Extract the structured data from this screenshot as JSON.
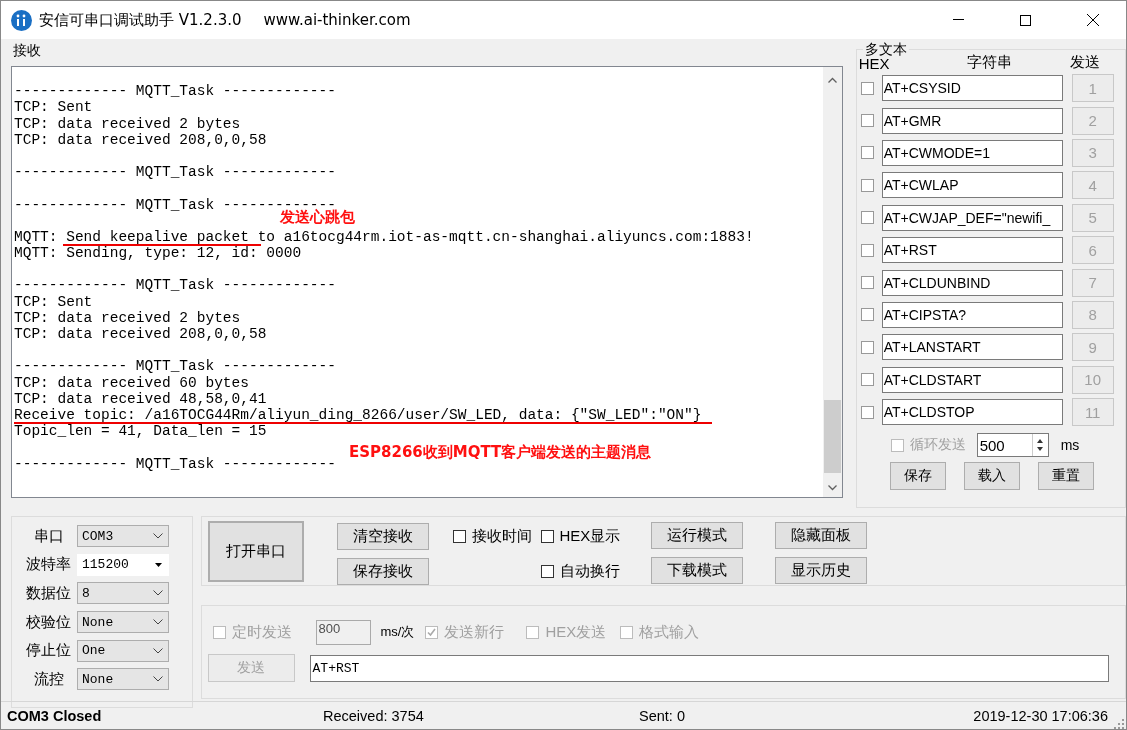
{
  "window": {
    "title": "安信可串口调试助手 V1.2.3.0",
    "url": "www.ai-thinker.com"
  },
  "receive": {
    "label": "接收",
    "blocks": [
      [
        "------------- MQTT_Task -------------",
        "TCP: Sent",
        "TCP: data received 2 bytes",
        "TCP: data received 208,0,0,58"
      ],
      [
        "------------- MQTT_Task -------------"
      ],
      [
        "------------- MQTT_Task -------------"
      ],
      [
        "MQTT: Send keepalive packet to a16tocg44rm.iot-as-mqtt.cn-shanghai.aliyuncs.com:1883!",
        "MQTT: Sending, type: 12, id: 0000"
      ],
      [
        "------------- MQTT_Task -------------",
        "TCP: Sent",
        "TCP: data received 2 bytes",
        "TCP: data received 208,0,0,58"
      ],
      [
        "------------- MQTT_Task -------------",
        "TCP: data received 60 bytes",
        "TCP: data received 48,58,0,41",
        "Receive topic: /a16TOCG44Rm/aliyun_ding_8266/user/SW_LED, data: {\"SW_LED\":\"ON\"}",
        "Topic_len = 41, Data_len = 15"
      ],
      [
        "------------- MQTT_Task -------------"
      ]
    ],
    "annotations": [
      {
        "text": "发送心跳包"
      },
      {
        "text": "ESP8266收到MQTT客户端发送的主题消息"
      }
    ]
  },
  "multi_text": {
    "title": "多文本",
    "headers": [
      "HEX",
      "字符串",
      "发送"
    ],
    "rows": [
      {
        "hex": false,
        "text": "AT+CSYSID",
        "button": "1",
        "disabled": true
      },
      {
        "hex": false,
        "text": "AT+GMR",
        "button": "2",
        "disabled": true
      },
      {
        "hex": false,
        "text": "AT+CWMODE=1",
        "button": "3",
        "disabled": true
      },
      {
        "hex": false,
        "text": "AT+CWLAP",
        "button": "4",
        "disabled": true
      },
      {
        "hex": false,
        "text": "AT+CWJAP_DEF=\"newifi_",
        "button": "5",
        "disabled": true
      },
      {
        "hex": false,
        "text": "AT+RST",
        "button": "6",
        "disabled": true
      },
      {
        "hex": false,
        "text": "AT+CLDUNBIND",
        "button": "7",
        "disabled": true
      },
      {
        "hex": false,
        "text": "AT+CIPSTA?",
        "button": "8",
        "disabled": true
      },
      {
        "hex": false,
        "text": "AT+LANSTART",
        "button": "9",
        "disabled": true
      },
      {
        "hex": false,
        "text": "AT+CLDSTART",
        "button": "10",
        "disabled": true
      },
      {
        "hex": false,
        "text": "AT+CLDSTOP",
        "button": "11",
        "disabled": true
      }
    ],
    "loop": {
      "label": "循环发送",
      "checked": false,
      "disabled": true,
      "interval": "500",
      "unit": "ms"
    },
    "buttons": [
      "保存",
      "载入",
      "重置"
    ]
  },
  "port_settings": [
    {
      "label": "串口",
      "value": "COM3",
      "kind": "dropdown"
    },
    {
      "label": "波特率",
      "value": "115200",
      "kind": "editable"
    },
    {
      "label": "数据位",
      "value": "8",
      "kind": "dropdown"
    },
    {
      "label": "校验位",
      "value": "None",
      "kind": "dropdown"
    },
    {
      "label": "停止位",
      "value": "One",
      "kind": "dropdown"
    },
    {
      "label": "流控",
      "value": "None",
      "kind": "dropdown"
    }
  ],
  "controls": {
    "open_button": "打开串口",
    "receive_buttons": [
      "清空接收",
      "保存接收"
    ],
    "checkboxes": [
      {
        "label": "接收时间",
        "checked": false
      },
      {
        "label": "HEX显示",
        "checked": false
      },
      {
        "label": "自动换行",
        "checked": false
      }
    ],
    "mode_buttons": [
      "运行模式",
      "下载模式"
    ],
    "panel_buttons": [
      "隐藏面板",
      "显示历史"
    ]
  },
  "send": {
    "timed": {
      "label": "定时发送",
      "checked": false,
      "disabled": true
    },
    "interval": {
      "value": "800",
      "disabled": true
    },
    "interval_unit": "ms/次",
    "options": [
      {
        "label": "发送新行",
        "checked": true,
        "disabled": true
      },
      {
        "label": "HEX发送",
        "checked": false,
        "disabled": true
      },
      {
        "label": "格式输入",
        "checked": false,
        "disabled": true
      }
    ],
    "send_button": {
      "label": "发送",
      "disabled": true
    },
    "input": "AT+RST"
  },
  "status_bar": {
    "port_status": "COM3 Closed",
    "received": "Received: 3754",
    "sent": "Sent: 0",
    "time": "2019-12-30 17:06:36"
  }
}
